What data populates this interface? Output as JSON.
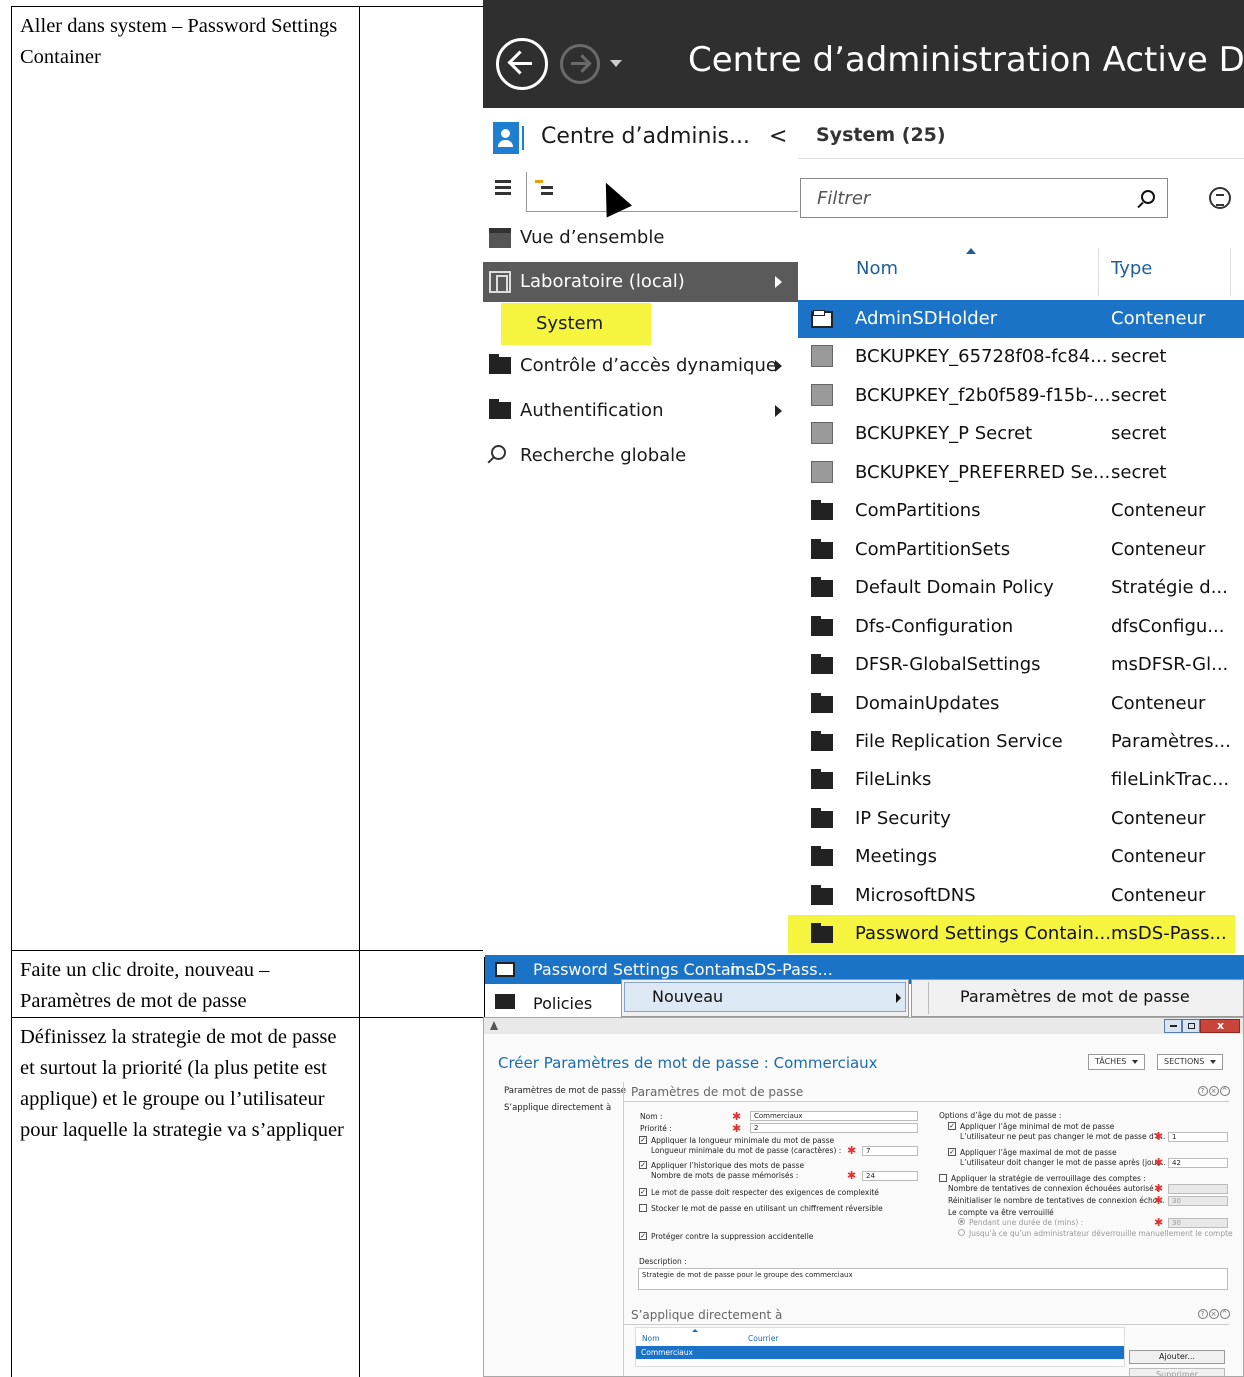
{
  "instructions": {
    "row1": "Aller dans system – Password Settings Container",
    "row2": "Faite un clic droite, nouveau – Paramètres de mot de passe",
    "row3": "Définissez la strategie de mot de passe et surtout la priorité (la plus petite est applique) et le groupe ou l’utilisateur pour laquelle la strategie va s’appliquer"
  },
  "ad_window": {
    "title": "Centre d’administration Active Dire",
    "left_title": "Centre d’adminis...",
    "collapse_glyph": "<",
    "nav": [
      {
        "label": "Vue d’ensemble"
      },
      {
        "label": "Laboratoire (local)"
      },
      {
        "label": "System"
      },
      {
        "label": "Contrôle d’accès dynamique"
      },
      {
        "label": "Authentification"
      },
      {
        "label": "Recherche globale"
      }
    ],
    "list_title": "System  (25)",
    "filter_placeholder": "Filtrer",
    "columns": {
      "name": "Nom",
      "type": "Type"
    },
    "rows": [
      {
        "name": "AdminSDHolder",
        "type": "Conteneur",
        "icon": "folder-icon"
      },
      {
        "name": "BCKUPKEY_65728f08-fc84...",
        "type": "secret",
        "icon": "secret-icon"
      },
      {
        "name": "BCKUPKEY_f2b0f589-f15b-...",
        "type": "secret",
        "icon": "secret-icon"
      },
      {
        "name": "BCKUPKEY_P Secret",
        "type": "secret",
        "icon": "secret-icon"
      },
      {
        "name": "BCKUPKEY_PREFERRED Se...",
        "type": "secret",
        "icon": "secret-icon"
      },
      {
        "name": "ComPartitions",
        "type": "Conteneur",
        "icon": "folder-icon"
      },
      {
        "name": "ComPartitionSets",
        "type": "Conteneur",
        "icon": "folder-icon"
      },
      {
        "name": "Default Domain Policy",
        "type": "Stratégie d...",
        "icon": "folder-icon"
      },
      {
        "name": "Dfs-Configuration",
        "type": "dfsConfigu...",
        "icon": "folder-icon"
      },
      {
        "name": "DFSR-GlobalSettings",
        "type": "msDFSR-Gl...",
        "icon": "folder-icon"
      },
      {
        "name": "DomainUpdates",
        "type": "Conteneur",
        "icon": "folder-icon"
      },
      {
        "name": "File Replication Service",
        "type": "Paramètres...",
        "icon": "folder-icon"
      },
      {
        "name": "FileLinks",
        "type": "fileLinkTrac...",
        "icon": "folder-icon"
      },
      {
        "name": "IP Security",
        "type": "Conteneur",
        "icon": "folder-icon"
      },
      {
        "name": "Meetings",
        "type": "Conteneur",
        "icon": "folder-icon"
      },
      {
        "name": "MicrosoftDNS",
        "type": "Conteneur",
        "icon": "folder-icon"
      },
      {
        "name": "Password Settings Contain...",
        "type": "msDS-Pass...",
        "icon": "folder-icon"
      }
    ]
  },
  "context_menu": {
    "row_name": "Password Settings Contain...",
    "row_type": "msDS-Pass...",
    "next_row": "Policies",
    "item": "Nouveau",
    "submenu_item": "Paramètres de mot de passe"
  },
  "create_dialog": {
    "title": "Créer Paramètres de mot de passe : Commerciaux",
    "tasks_button": "TÂCHES",
    "sections_button": "SECTIONS",
    "nav": [
      "Paramètres de mot de passe",
      "S’applique directement à"
    ],
    "section1": "Paramètres de mot de passe",
    "section2": "S’applique directement à",
    "fields": {
      "nom_label": "Nom :",
      "nom_value": "Commerciaux",
      "priorite_label": "Priorité :",
      "priorite_value": "2",
      "min_len_cb": "Appliquer la longueur minimale du mot de passe",
      "min_len_label": "Longueur minimale du mot de passe (caractères) :",
      "min_len_value": "7",
      "history_cb": "Appliquer l’historique des mots de passe",
      "history_label": "Nombre de mots de passe mémorisés :",
      "history_value": "24",
      "complexity_cb": "Le mot de passe doit respecter des exigences de complexité",
      "reversible_cb": "Stocker le mot de passe en utilisant un chiffrement réversible",
      "protect_cb": "Protéger contre la suppression accidentelle",
      "description_label": "Description :",
      "description_value": "Strategie de mot de passe pour le groupe des commerciaux",
      "age_title": "Options d’âge du mot de passe :",
      "min_age_cb": "Appliquer l’âge minimal de mot de passe",
      "min_age_label": "L’utilisateur ne peut pas changer le mot de passe d’i...",
      "min_age_value": "1",
      "max_age_cb": "Appliquer l’âge maximal de mot de passe",
      "max_age_label": "L’utilisateur doit changer le mot de passe après (jour...",
      "max_age_value": "42",
      "lockout_cb": "Appliquer la stratégie de verrouillage des comptes :",
      "lockout_attempts": "Nombre de tentatives de connexion échouées autorisé :",
      "lockout_reset": "Réinitialiser le nombre de tentatives de connexion écho...",
      "lockout_reset_value": "30",
      "lockout_locked": "Le compte va être verrouillé",
      "lockout_duration": "Pendant une durée de (mins) :",
      "lockout_duration_value": "30",
      "lockout_manual": "Jusqu’à ce qu’un administrateur déverrouille manuellement le compte"
    },
    "grid": {
      "col_name": "Nom",
      "col_mail": "Courrier",
      "row": "Commerciaux"
    },
    "add_button": "Ajouter...",
    "delete_button": "Supprimer"
  }
}
